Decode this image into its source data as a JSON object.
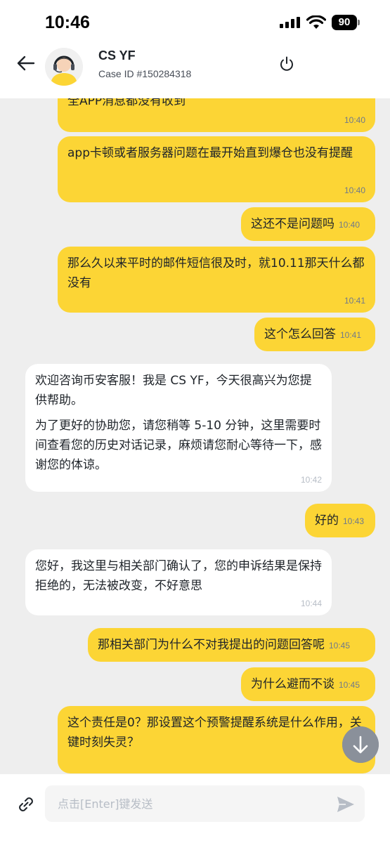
{
  "status_bar": {
    "time": "10:46",
    "battery": "90"
  },
  "header": {
    "agent_name": "CS YF",
    "case_id": "Case ID #150284318",
    "icons": {
      "back": "arrow-left-icon",
      "avatar": "support-agent-avatar",
      "end": "power-icon"
    }
  },
  "messages": [
    {
      "side": "out",
      "text": "全APP消息都没有收到",
      "time": "10:40"
    },
    {
      "side": "out",
      "text": "app卡顿或者服务器问题在最开始直到爆仓也没有提醒",
      "time": "10:40"
    },
    {
      "side": "out",
      "text": "这还不是问题吗",
      "time": "10:40"
    },
    {
      "side": "out",
      "text": "那么久以来平时的邮件短信很及时，就10.11那天什么都没有",
      "time": "10:41"
    },
    {
      "side": "out",
      "text": "这个怎么回答",
      "time": "10:41"
    },
    {
      "side": "in",
      "text": "欢迎咨询币安客服！我是 CS YF，今天很高兴为您提供帮助。",
      "text2": "为了更好的协助您，请您稍等 5-10 分钟，这里需要时间查看您的历史对话记录，麻烦请您耐心等待一下，感谢您的体谅。",
      "time": "10:42"
    },
    {
      "side": "out",
      "text": "好的",
      "time": "10:43"
    },
    {
      "side": "in",
      "text": "您好，我这里与相关部门确认了，您的申诉结果是保持拒绝的，无法被改变，不好意思",
      "time": "10:44"
    },
    {
      "side": "out",
      "text": "那相关部门为什么不对我提出的问题回答呢",
      "time": "10:45"
    },
    {
      "side": "out",
      "text": "为什么避而不谈",
      "time": "10:45"
    },
    {
      "side": "out",
      "text": "这个责任是0？那设置这个预警提醒系统是什么作用，关键时刻失灵？",
      "time": ""
    }
  ],
  "input": {
    "placeholder": "点击[Enter]键发送"
  },
  "colors": {
    "outgoing": "#fcd535",
    "incoming": "#ffffff",
    "background": "#eeeeee"
  }
}
